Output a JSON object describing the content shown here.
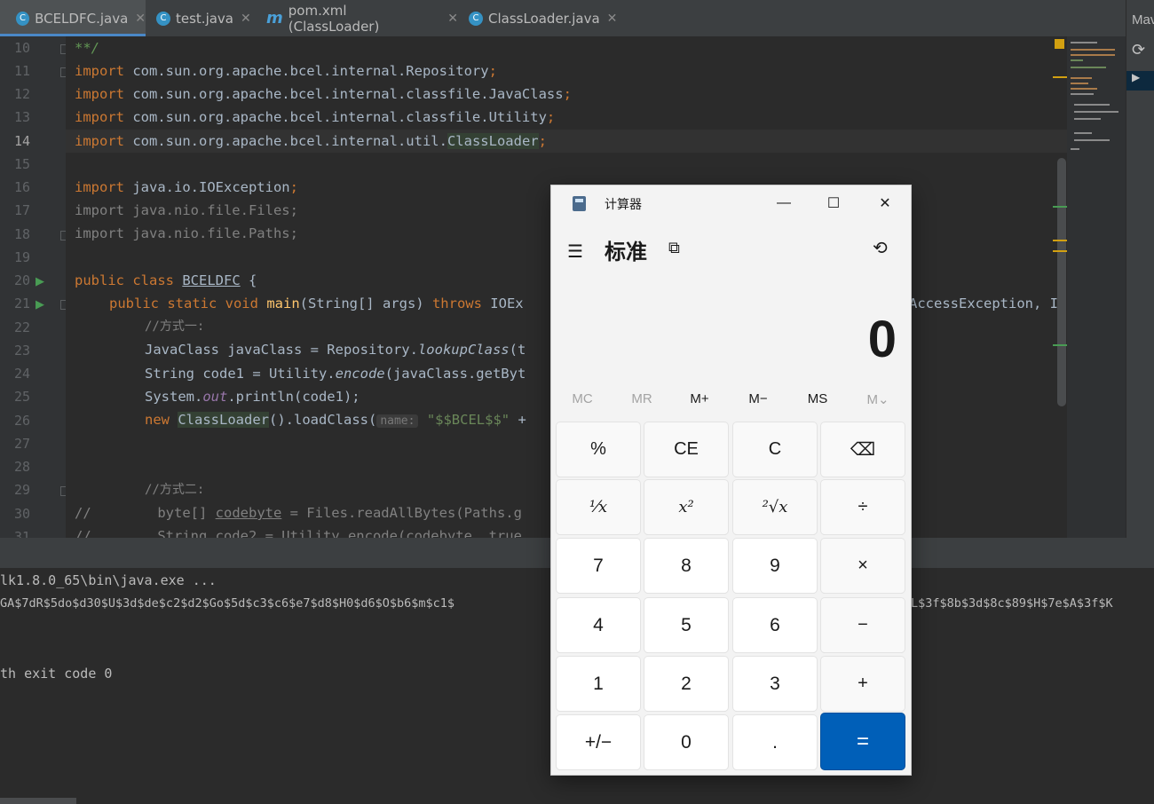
{
  "tabs": [
    {
      "label": "BCELDFC.java",
      "icon": "java-class-icon"
    },
    {
      "label": "test.java",
      "icon": "java-class-icon"
    },
    {
      "label": "pom.xml (ClassLoader)",
      "icon": "maven-icon"
    },
    {
      "label": "ClassLoader.java",
      "icon": "java-class-icon"
    }
  ],
  "right_panel": {
    "title": "Mav"
  },
  "line_numbers": [
    "10",
    "11",
    "12",
    "13",
    "14",
    "15",
    "16",
    "17",
    "18",
    "19",
    "20",
    "21",
    "22",
    "23",
    "24",
    "25",
    "26",
    "27",
    "28",
    "29",
    "30",
    "31"
  ],
  "code": {
    "l10": "**/",
    "import_kw": "import",
    "l11": " com.sun.org.apache.bcel.internal.Repository",
    "l12": " com.sun.org.apache.bcel.internal.classfile.JavaClass",
    "l13": " com.sun.org.apache.bcel.internal.classfile.Utility",
    "l14a": " com.sun.org.apache.bcel.internal.util.",
    "l14b": "ClassLoader",
    "semi": ";",
    "l16": " java.io.IOException",
    "l17": "import java.nio.file.Files;",
    "l18": "import java.nio.file.Paths;",
    "l20_kw": "public class",
    "l20_name": "BCELDFC",
    "l20_rest": " {",
    "l21_kw": "public static void",
    "l21_fn": "main",
    "l21_args": "(String[] args) ",
    "l21_throws": "throws",
    "l21_rest": " IOEx",
    "l21_tail": "AccessException, I",
    "l22": "//方式一:",
    "l23a": "JavaClass javaClass = Repository.",
    "l23b": "lookupClass",
    "l23c": "(t",
    "l24a": "String code1 = Utility.",
    "l24b": "encode",
    "l24c": "(javaClass.getByt",
    "l25a": "System.",
    "l25b": "out",
    "l25c": ".println(code1);",
    "l26_kw": "new",
    "l26_cls": "ClassLoader",
    "l26_mid": "().loadClass(",
    "l26_hint": "name:",
    "l26_str": "\"$$BCEL$$\"",
    "l26_rest": " +",
    "l29": "//方式二:",
    "l30a": "//",
    "l30b": "        byte[] ",
    "l30c": "codebyte",
    "l30d": " = Files.readAllBytes(Paths.g",
    "l31": "//        String code2 = Utility.encode(codebyte, true"
  },
  "console": {
    "line1": "lk1.8.0_65\\bin\\java.exe ...",
    "line2a": "GA$7dR$5do$d30$U$3d$de$c2$d2$Go$5d$c3$c6$e7$d8$H0$d6$O$b6$m$c1$",
    "line2b": "L$3f$8b$3d$8c$89$H$7e$A$3f$K",
    "line3": "th exit code 0"
  },
  "calculator": {
    "title": "计算器",
    "mode": "标准",
    "display": "0",
    "memory": [
      "MC",
      "MR",
      "M+",
      "M−",
      "MS",
      "M⌄"
    ],
    "memory_enabled": [
      false,
      false,
      true,
      true,
      true,
      false
    ],
    "keys": [
      [
        "%",
        "CE",
        "C",
        "⌫"
      ],
      [
        "¹⁄x",
        "x²",
        "²√x",
        "÷"
      ],
      [
        "7",
        "8",
        "9",
        "×"
      ],
      [
        "4",
        "5",
        "6",
        "−"
      ],
      [
        "1",
        "2",
        "3",
        "+"
      ],
      [
        "+/−",
        "0",
        ".",
        "="
      ]
    ],
    "accent": "#005fb8"
  }
}
